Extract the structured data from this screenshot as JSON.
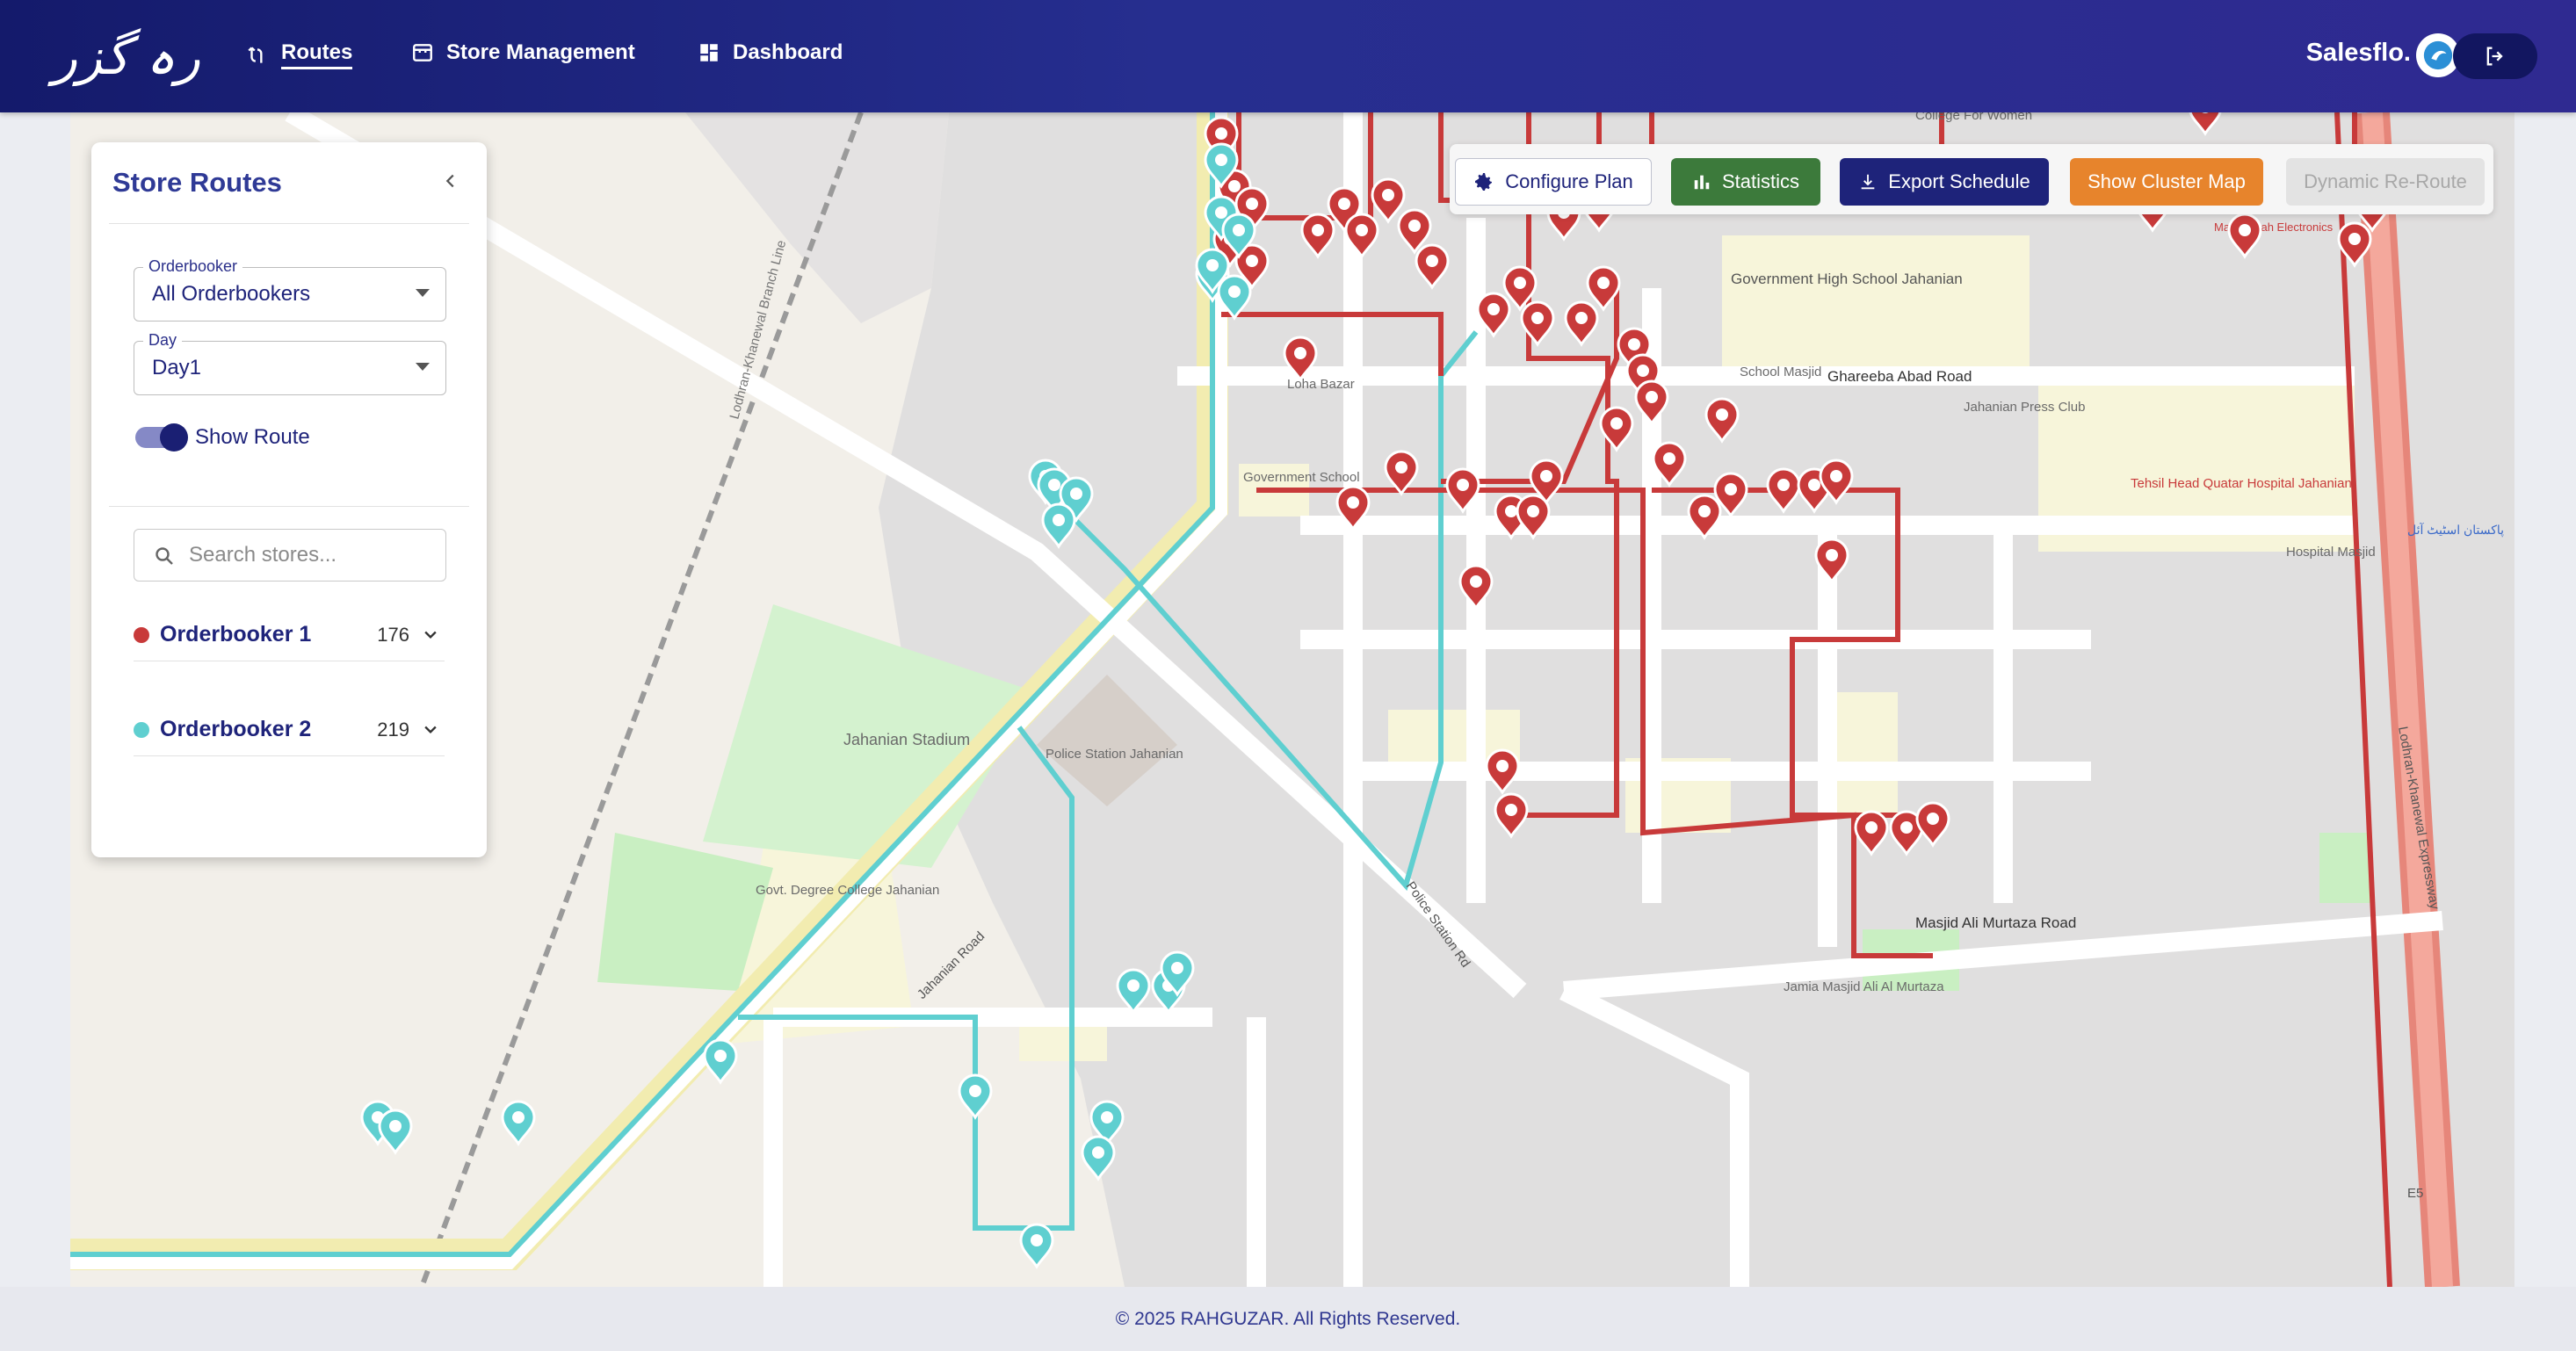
{
  "app": {
    "logo_text": "رہ گزر",
    "brand": "Salesflo."
  },
  "nav": [
    {
      "label": "Routes",
      "icon": "route-icon",
      "active": true
    },
    {
      "label": "Store Management",
      "icon": "store-icon",
      "active": false
    },
    {
      "label": "Dashboard",
      "icon": "dashboard-icon",
      "active": false
    }
  ],
  "toolbar": {
    "configure": "Configure Plan",
    "statistics": "Statistics",
    "export": "Export Schedule",
    "cluster": "Show Cluster Map",
    "reroute": "Dynamic Re-Route"
  },
  "panel": {
    "title": "Store Routes",
    "orderbooker_label": "Orderbooker",
    "orderbooker_value": "All Orderbookers",
    "day_label": "Day",
    "day_value": "Day1",
    "show_route_label": "Show Route",
    "search_placeholder": "Search stores...",
    "orderbookers": [
      {
        "name": "Orderbooker 1",
        "count": "176",
        "color": "#c83a3a"
      },
      {
        "name": "Orderbooker 2",
        "count": "219",
        "color": "#5fcfd0"
      }
    ]
  },
  "map": {
    "labels": [
      "College For Women",
      "Government High School Jahanian",
      "Ghareeba Abad Road",
      "Jahanian Press Club",
      "Tehsil Head Quatar Hospital Jahanian",
      "Hospital Masjid",
      "School Masjid",
      "Loha Bazar",
      "Government School",
      "Jahanian Stadium",
      "Police Station Jahanian",
      "Govt. Degree College Jahanian",
      "Jahanian Road",
      "Police Station Rd",
      "Masjid Ali Murtaza Road",
      "Jamia Masjid Ali Al Murtaza",
      "Lodhran-Khanewal Branch Line",
      "MashaAllah Electronics",
      "پاکستان اسٹیٹ آئل",
      "Lodhran-Khanewal Expressway",
      "E5"
    ]
  },
  "footer": {
    "text": "© 2025 RAHGUZAR. All Rights Reserved."
  }
}
